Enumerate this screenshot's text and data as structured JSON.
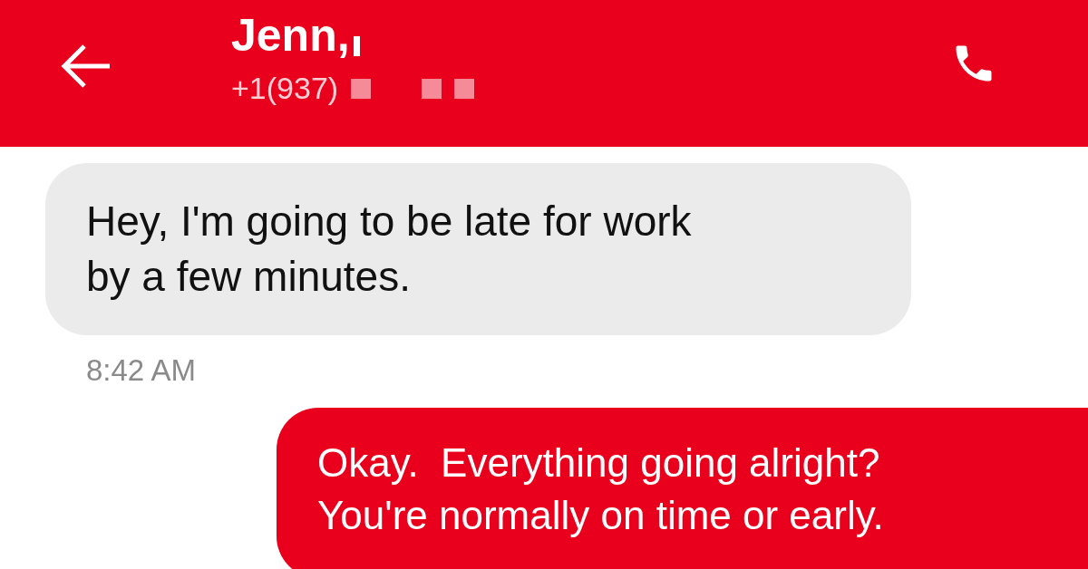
{
  "header": {
    "title": "Jenn,",
    "subtitle": "+1(937)"
  },
  "messages": [
    {
      "kind": "incoming",
      "text": "Hey, I'm going to be late for work\nby a few minutes.",
      "time": "8:42 AM"
    },
    {
      "kind": "outgoing",
      "text": "Okay.  Everything going alright?\nYou're normally on time or early."
    }
  ]
}
